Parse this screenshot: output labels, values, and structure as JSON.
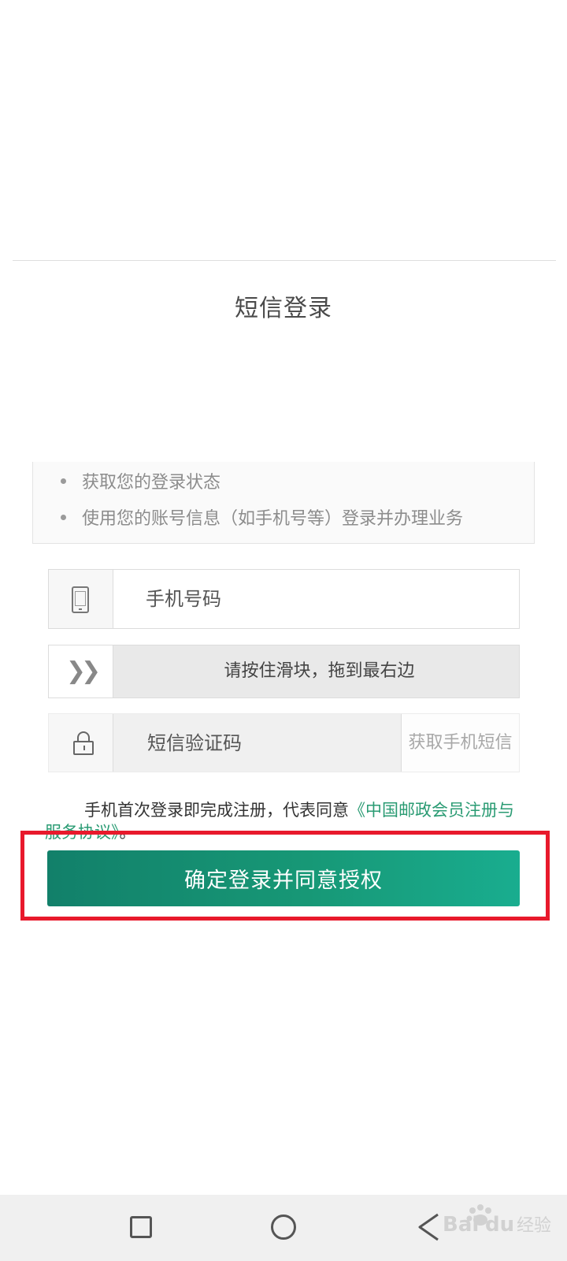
{
  "header": {
    "title": "短信登录"
  },
  "permissions": {
    "items": [
      "获取您的登录状态",
      "使用您的账号信息（如手机号等）登录并办理业务"
    ]
  },
  "form": {
    "phone_placeholder": "手机号码",
    "slider_text": "请按住滑块，拖到最右边",
    "sms_placeholder": "短信验证码",
    "get_sms_label": "获取手机短信"
  },
  "agreement": {
    "prefix": "手机首次登录即完成注册，代表同意",
    "link": "《中国邮政会员注册与服务协议》",
    "suffix": "。"
  },
  "submit": {
    "label": "确定登录并同意授权"
  },
  "watermark": {
    "text": "Baidu经验"
  },
  "colors": {
    "accent_green": "#179876",
    "link_green": "#2a9b73",
    "highlight_red": "#e8192c"
  },
  "icons": {
    "phone": "phone-icon",
    "slider": "double-chevron-right-icon",
    "lock": "lock-icon",
    "nav_recent": "square-icon",
    "nav_home": "circle-icon",
    "nav_back": "triangle-back-icon"
  }
}
